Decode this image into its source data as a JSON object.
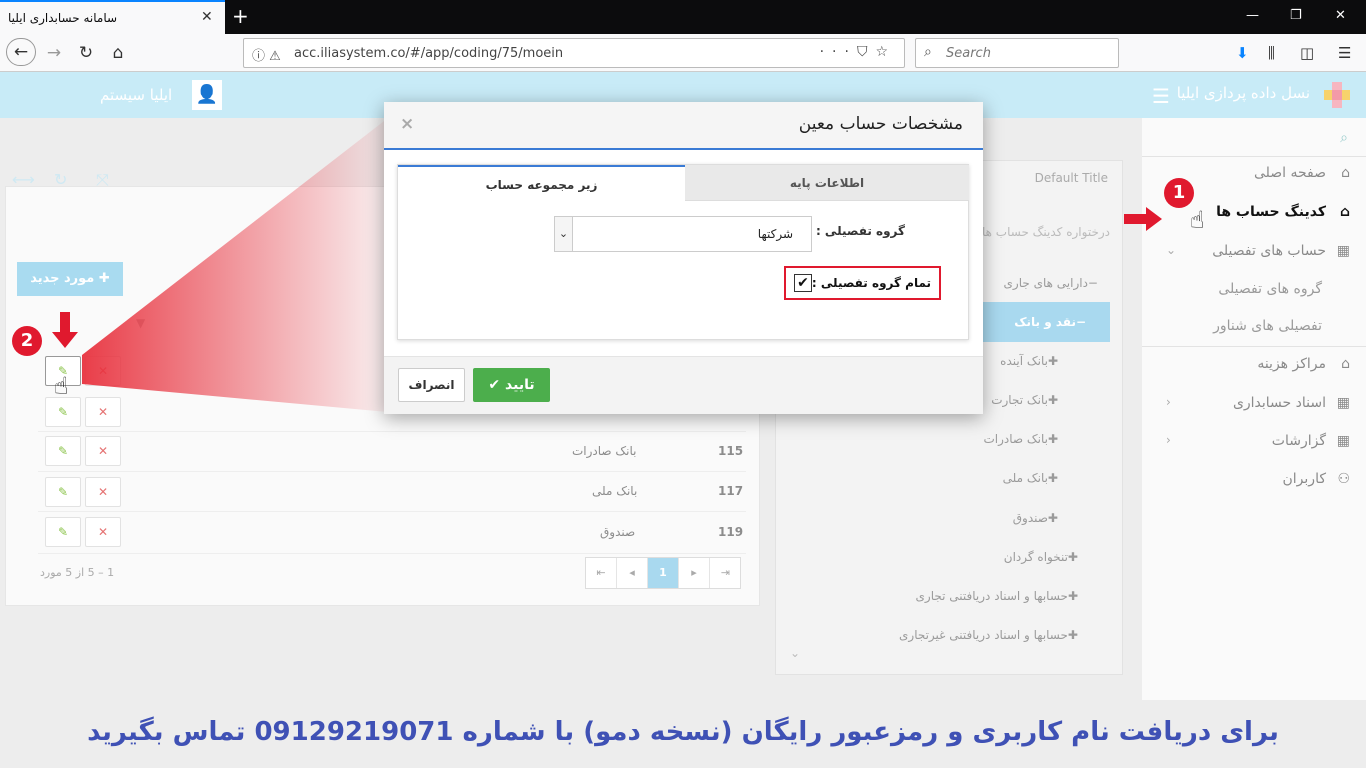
{
  "browser": {
    "tab_title": "سامانه حسابداری ایلیا",
    "url": "acc.iliasystem.co/#/app/coding/75/moein",
    "search_placeholder": "Search"
  },
  "header": {
    "brand": "نسل داده پردازی ایلیا",
    "user_name": "ایلیا سیستم"
  },
  "sidebar": {
    "items": [
      {
        "label": "صفحه اصلی"
      },
      {
        "label": "کدینگ حساب ها"
      },
      {
        "label": "حساب های تفصیلی"
      },
      {
        "label": "مراکز هزینه"
      },
      {
        "label": "اسناد حسابداری"
      },
      {
        "label": "گزارشات"
      },
      {
        "label": "کاربران"
      }
    ],
    "subitems": [
      "گروه های تفصیلی",
      "تفصیلی های شناور"
    ]
  },
  "tree": {
    "title": "Default Title",
    "header": "درختواره کدینگ حساب ها",
    "items": [
      "−دارایی های جاری",
      "−نقد و بانک",
      "✚بانک آینده",
      "✚بانک تجارت",
      "✚بانک صادرات",
      "✚بانک ملی",
      "✚صندوق",
      "✚تنخواه گردان",
      "✚حسابها و اسناد دریافتنی تجاری",
      "✚حسابها و اسناد دریافتنی غیرتجاری"
    ]
  },
  "list": {
    "new_button": "مورد جدید",
    "rows": [
      {
        "code": "115",
        "name": "بانک صادرات"
      },
      {
        "code": "117",
        "name": "بانک ملی"
      },
      {
        "code": "119",
        "name": "صندوق"
      }
    ],
    "pager_page": "1",
    "pager_info": "1 – 5 از 5 مورد"
  },
  "modal": {
    "title": "مشخصات حساب معین",
    "tab_base": "اطلاعات پایه",
    "tab_sub": "زیر مجموعه حساب",
    "group_label": "گروه تفصیلی :",
    "group_value": "شرکتها",
    "all_group_label": "تمام گروه تفصیلی :",
    "ok_label": "تایید",
    "cancel_label": "انصراف"
  },
  "annotations": {
    "step1": "1",
    "step2": "2"
  },
  "banner": "برای دریافت نام کاربری و رمزعبور رایگان (نسخه دمو) با شماره 09129219071 تماس بگیرید",
  "colors": {
    "accent_blue": "#3a7bd5",
    "header_bg": "#c8ebf7",
    "highlight_red": "#e0192e",
    "ok_green": "#4cae4c",
    "banner_text": "#3f51b5"
  }
}
